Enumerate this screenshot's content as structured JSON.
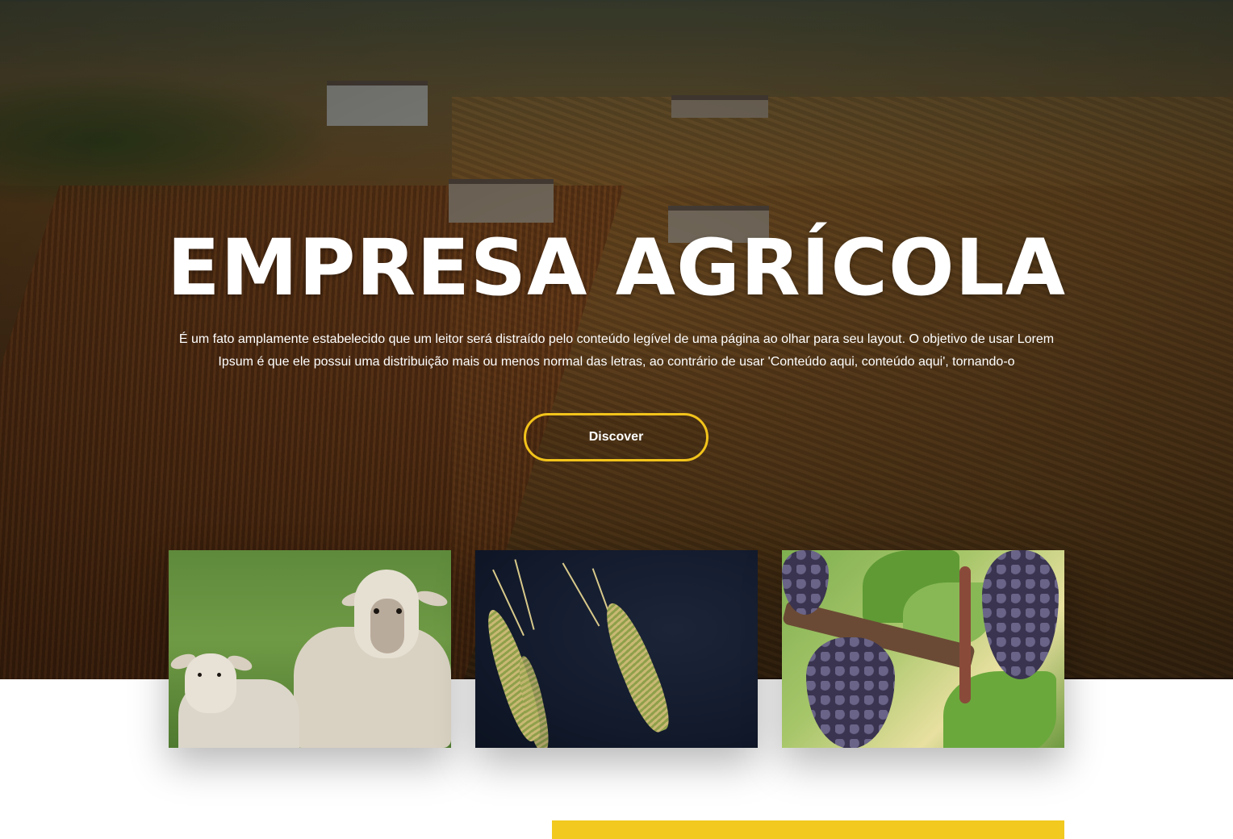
{
  "hero": {
    "title": "EMPRESA AGRÍCOLA",
    "description": "É um fato amplamente estabelecido que um leitor será distraído pelo conteúdo legível de uma página ao olhar para seu layout. O objetivo de usar Lorem Ipsum é que ele possui uma distribuição mais ou menos normal das letras, ao contrário de usar 'Conteúdo aqui, conteúdo aqui', tornando-o",
    "button_label": "Discover",
    "background_image": "aerial-farm-fields"
  },
  "cards": [
    {
      "image": "sheep"
    },
    {
      "image": "wheat-ears"
    },
    {
      "image": "grapes-vine"
    }
  ],
  "colors": {
    "accent": "#f2c31b",
    "text_on_hero": "#ffffff",
    "page_bg": "#ffffff",
    "accent_bar": "#f2c91f"
  }
}
